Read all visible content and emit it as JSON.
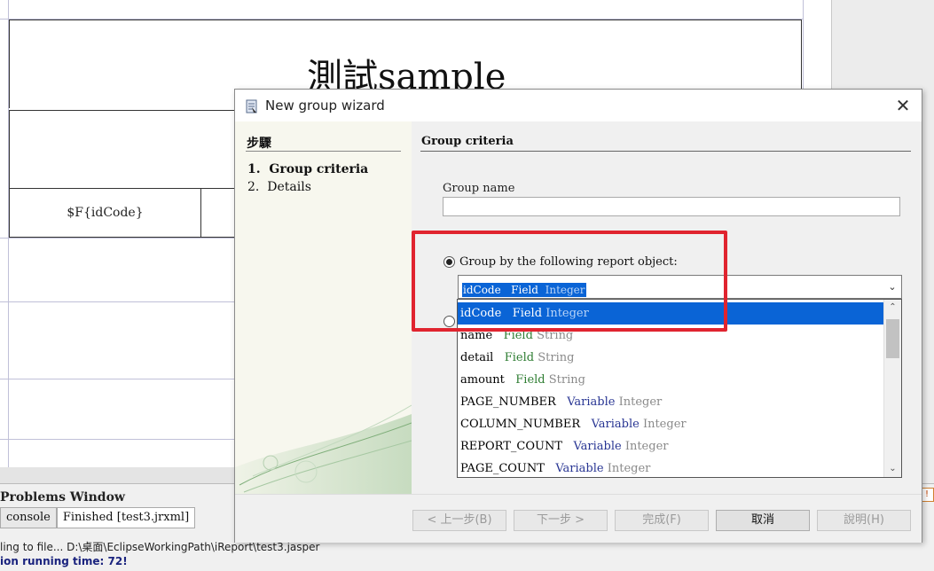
{
  "report": {
    "title_text": "測試sample",
    "field_cell": "$F{idCode}"
  },
  "bottom": {
    "problems_title": "Problems Window",
    "tabs": [
      "console",
      "Finished [test3.jrxml]"
    ],
    "log_line1": "ling to file... D:\\桌面\\EclipseWorkingPath\\iReport\\test3.jasper",
    "log_line2": "ion running time: 72!"
  },
  "dialog": {
    "title": "New group wizard",
    "close_glyph": "✕",
    "steps_heading": "步驟",
    "steps": [
      {
        "num": "1.",
        "label": "Group criteria"
      },
      {
        "num": "2.",
        "label": "Details"
      }
    ],
    "content_heading": "Group criteria",
    "group_name_label": "Group name",
    "group_name_value": "",
    "radio_label": "Group by the following report object:",
    "combo_selected": {
      "name": "idCode",
      "kind": "Field",
      "type": "Integer"
    },
    "dropdown_items": [
      {
        "name": "idCode",
        "kind": "Field",
        "type": "Integer"
      },
      {
        "name": "name",
        "kind": "Field",
        "type": "String"
      },
      {
        "name": "detail",
        "kind": "Field",
        "type": "String"
      },
      {
        "name": "amount",
        "kind": "Field",
        "type": "String"
      },
      {
        "name": "PAGE_NUMBER",
        "kind": "Variable",
        "type": "Integer"
      },
      {
        "name": "COLUMN_NUMBER",
        "kind": "Variable",
        "type": "Integer"
      },
      {
        "name": "REPORT_COUNT",
        "kind": "Variable",
        "type": "Integer"
      },
      {
        "name": "PAGE_COUNT",
        "kind": "Variable",
        "type": "Integer"
      }
    ],
    "buttons": {
      "back": "< 上一步(B)",
      "next": "下一步 >",
      "finish": "完成(F)",
      "cancel": "取消",
      "help": "說明(H)"
    }
  },
  "colors": {
    "selection": "#0a64d6",
    "highlight_box": "#e0242f",
    "field_kind": "#2e7d32",
    "variable_kind": "#283593"
  }
}
